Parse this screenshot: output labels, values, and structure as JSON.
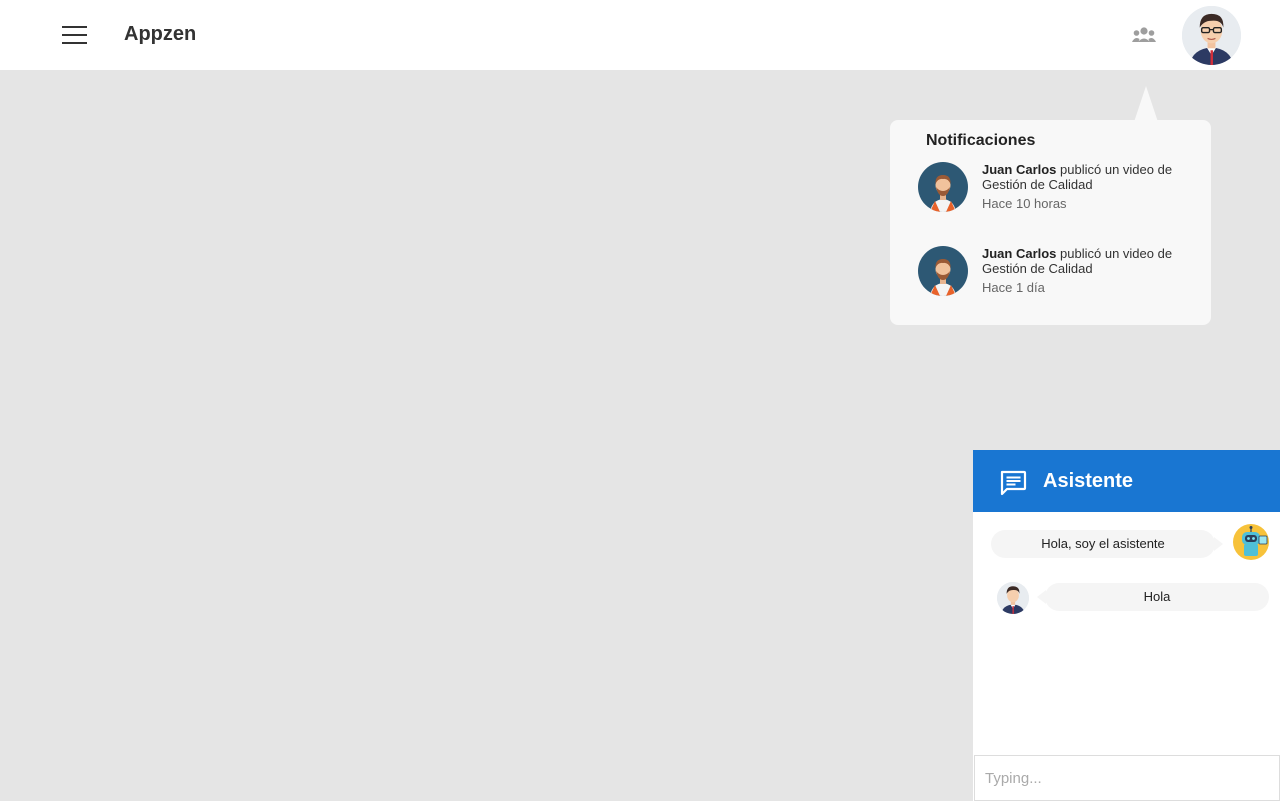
{
  "app": {
    "title": "Appzen"
  },
  "notifications": {
    "heading": "Notificaciones",
    "items": [
      {
        "author": "Juan Carlos",
        "action": " publicó un video de Gestión de Calidad",
        "time": "Hace 10 horas"
      },
      {
        "author": "Juan Carlos",
        "action": " publicó un video de Gestión de Calidad",
        "time": "Hace 1 día"
      }
    ]
  },
  "chat": {
    "title": "Asistente",
    "messages": [
      {
        "from": "bot",
        "text": "Hola, soy el asistente"
      },
      {
        "from": "user",
        "text": "Hola"
      }
    ],
    "input_placeholder": "Typing..."
  },
  "colors": {
    "accent": "#1976d2",
    "background": "#e5e5e5",
    "panel": "#f8f8f8"
  },
  "icons": [
    "menu-icon",
    "people-icon",
    "chat-icon"
  ]
}
